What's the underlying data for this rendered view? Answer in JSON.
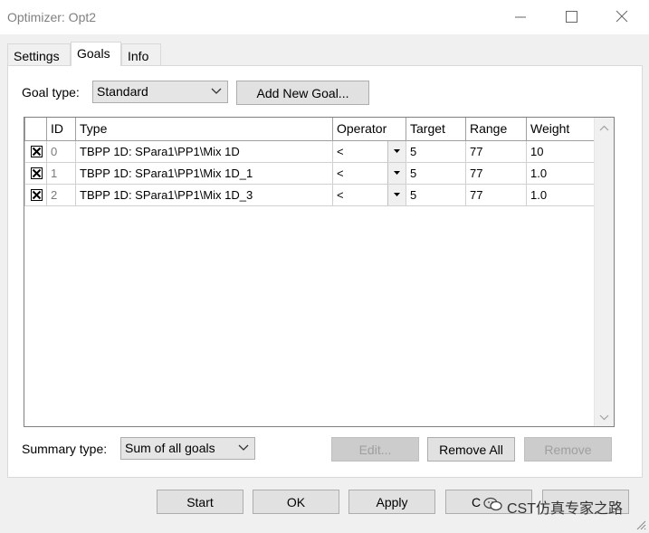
{
  "window": {
    "title": "Optimizer: Opt2",
    "icons": [
      "minimize-icon",
      "maximize-icon",
      "close-icon"
    ]
  },
  "tabs": [
    {
      "label": "Settings",
      "active": false
    },
    {
      "label": "Goals",
      "active": true
    },
    {
      "label": "Info",
      "active": false
    }
  ],
  "goals": {
    "goal_type_label": "Goal type:",
    "goal_type_value": "Standard",
    "add_new_goal_label": "Add New Goal...",
    "table": {
      "columns": [
        "ID",
        "Type",
        "Operator",
        "Target",
        "Range",
        "Weight"
      ],
      "rows": [
        {
          "checked": true,
          "id": "0",
          "type": "TBPP 1D: SPara1\\PP1\\Mix 1D",
          "operator": "<",
          "target": "5",
          "range": "77",
          "weight": "10"
        },
        {
          "checked": true,
          "id": "1",
          "type": "TBPP 1D: SPara1\\PP1\\Mix 1D_1",
          "operator": "<",
          "target": "5",
          "range": "77",
          "weight": "1.0"
        },
        {
          "checked": true,
          "id": "2",
          "type": "TBPP 1D: SPara1\\PP1\\Mix 1D_3",
          "operator": "<",
          "target": "5",
          "range": "77",
          "weight": "1.0"
        }
      ]
    },
    "summary_type_label": "Summary type:",
    "summary_type_value": "Sum of all goals",
    "edit_label": "Edit...",
    "remove_all_label": "Remove All",
    "remove_label": "Remove"
  },
  "footer": {
    "start_label": "Start",
    "ok_label": "OK",
    "apply_label": "Apply",
    "cancel_label_visible": "C",
    "watermark_text": "CST仿真专家之路"
  }
}
